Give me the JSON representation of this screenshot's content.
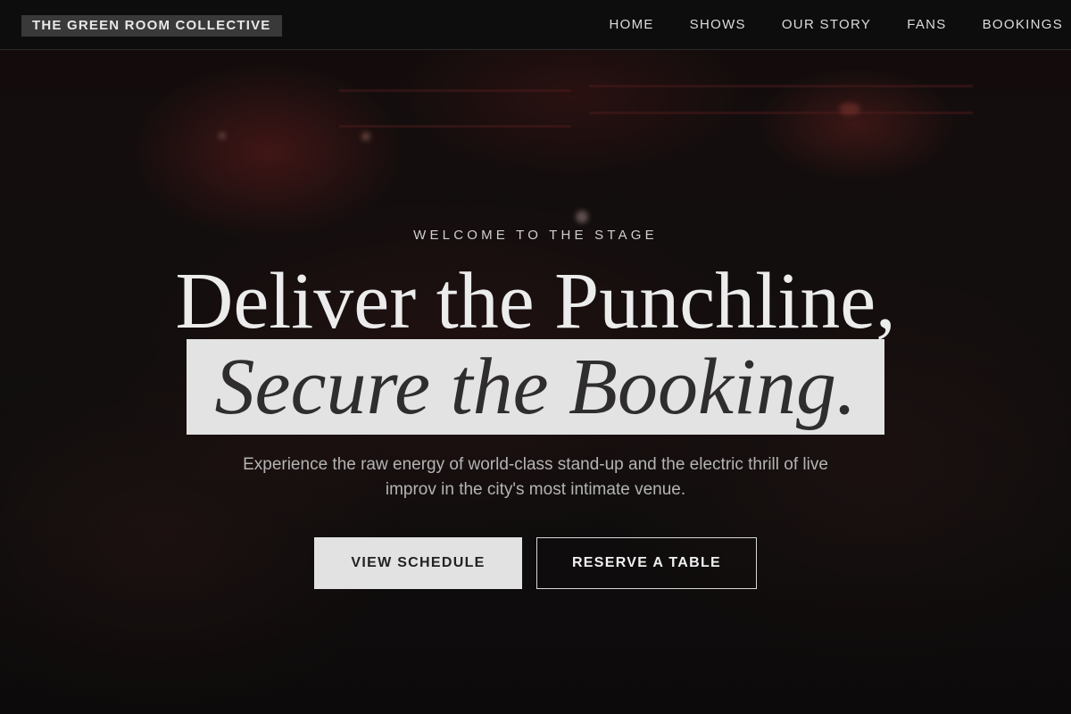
{
  "nav": {
    "brand": "THE GREEN ROOM COLLECTIVE",
    "links": [
      "HOME",
      "SHOWS",
      "OUR STORY",
      "FANS",
      "BOOKINGS"
    ]
  },
  "hero": {
    "eyebrow": "WELCOME TO THE STAGE",
    "headline_line1": "Deliver the Punchline,",
    "headline_line2": "Secure the Booking.",
    "subtext": "Experience the raw energy of world-class stand-up and the electric thrill of live improv in the city's most intimate venue.",
    "primary_button": "VIEW SCHEDULE",
    "secondary_button": "RESERVE A TABLE"
  },
  "colors": {
    "nav_background": "#0e0d0d",
    "brand_badge": "#3a3939",
    "highlight": "#e3e3e3",
    "hero_overlay": "#130f0f"
  }
}
